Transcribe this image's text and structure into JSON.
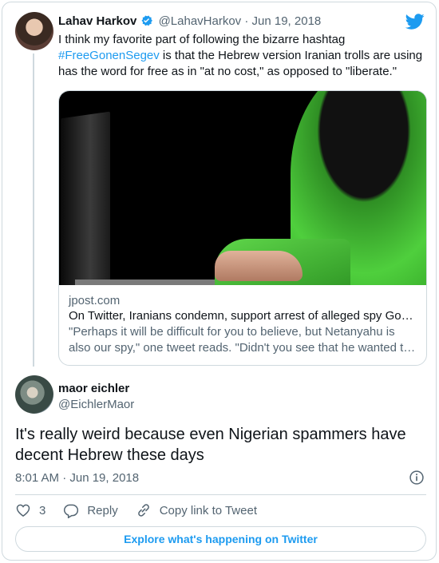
{
  "colors": {
    "accent": "#1d9bf0",
    "muted": "#536471",
    "border": "#cfd9de"
  },
  "tweet1": {
    "name": "Lahav Harkov",
    "handle": "@LahavHarkov",
    "separator": "·",
    "date": "Jun 19, 2018",
    "text_before": "I think my favorite part of following the bizarre hashtag",
    "hashtag": "#FreeGonenSegev",
    "text_after": " is that the Hebrew version Iranian trolls are using has the word for free as in \"at no cost,\" as opposed to \"liberate.\"",
    "link_card": {
      "domain": "jpost.com",
      "title": "On Twitter, Iranians condemn, support arrest of alleged spy Go…",
      "description": "\"Perhaps it will be difficult for you to believe, but Netanyahu is also our spy,\" one tweet reads. \"Didn't you see that he wanted t…"
    }
  },
  "tweet2": {
    "name": "maor eichler",
    "handle": "@EichlerMaor",
    "text": "It's really weird because even Nigerian spammers have decent Hebrew these days",
    "time": "8:01 AM · Jun 19, 2018"
  },
  "actions": {
    "like_count": "3",
    "reply_label": "Reply",
    "copy_label": "Copy link to Tweet"
  },
  "explore_label": "Explore what's happening on Twitter"
}
